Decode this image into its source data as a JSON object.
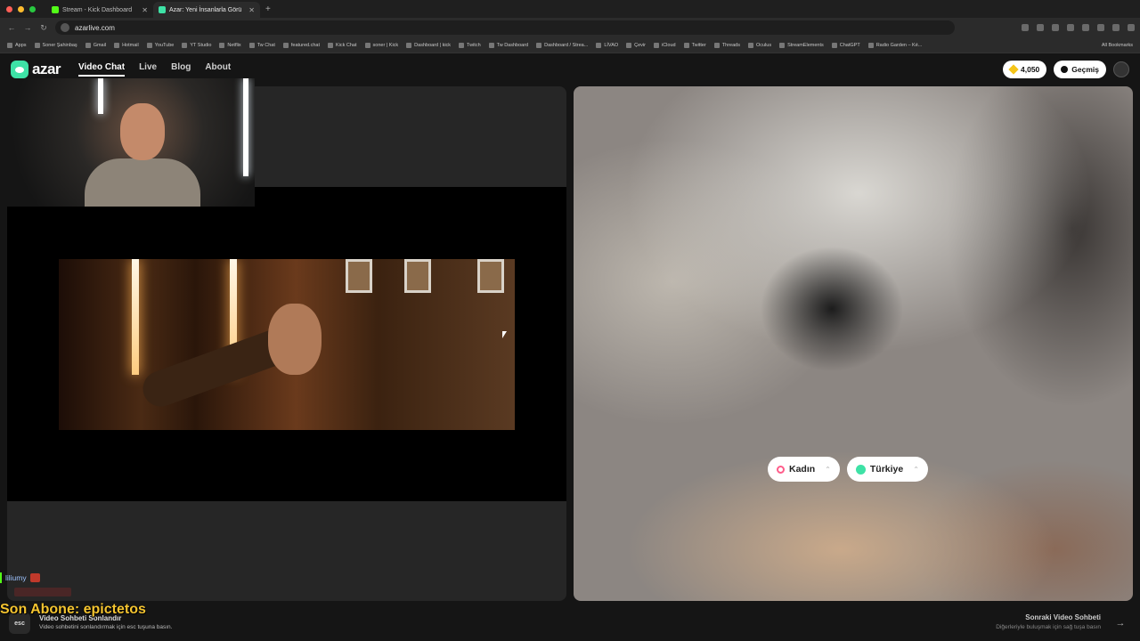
{
  "browser": {
    "tabs": [
      {
        "label": "Stream - Kick Dashboard",
        "active": false
      },
      {
        "label": "Azar: Yeni İnsanlarla Görü",
        "active": true
      }
    ],
    "new_tab": "+",
    "url": "azarlive.com",
    "bookmarks": [
      "Apps",
      "Soner Şahinbaş",
      "Gmail",
      "Hotmail",
      "YouTube",
      "YT Studio",
      "Netflix",
      "Tw Chat",
      "featured.chat",
      "Kick Chat",
      "soner | Kick",
      "Dashboard | kick",
      "Twitch",
      "Tw Dashboard",
      "Dashboard / Strea...",
      "LİVAO",
      "Çevir",
      "iCloud",
      "Twitter",
      "Threads",
      "Oculus",
      "StreamElements",
      "ChatGPT",
      "Radio Garden – Ké..."
    ],
    "all_bookmarks": "All Bookmarks",
    "traffic_colors": [
      "#ff5f57",
      "#febc2e",
      "#28c840"
    ]
  },
  "azar": {
    "logo_text": "azar",
    "nav": [
      {
        "label": "Video Chat",
        "active": true
      },
      {
        "label": "Live",
        "active": false
      },
      {
        "label": "Blog",
        "active": false
      },
      {
        "label": "About",
        "active": false
      }
    ],
    "gems": "4,050",
    "history_label": "Geçmiş",
    "filters": {
      "gender_label": "Kadın",
      "country_label": "Türkiye"
    },
    "bottom": {
      "esc_key": "esc",
      "end_title": "Video Sohbeti Sonlandır",
      "end_desc": "Video sohbetini sonlandırmak için esc tuşuna basın.",
      "next_title": "Sonraki Video Sohbeti",
      "next_desc": "Diğerleriyle buluşmak için sağ tuşa basın",
      "arrow": "→"
    }
  },
  "overlay": {
    "chat_username": "liliumy",
    "sub_alert": "Son Abone: epictetos"
  },
  "colors": {
    "accent": "#3ee2a6",
    "kick_green": "#53fc18",
    "alert_yellow": "#f4c430"
  }
}
